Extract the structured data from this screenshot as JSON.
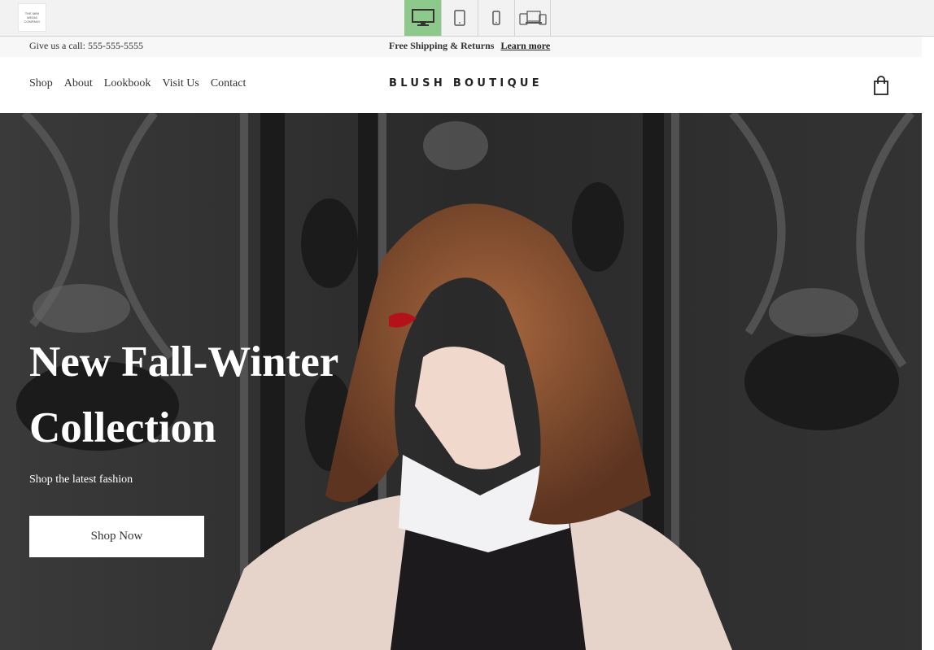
{
  "toolbar": {
    "logo_text": "THE MINI MEDIA COMPANY",
    "devices": [
      {
        "icon": "desktop-icon",
        "active": true
      },
      {
        "icon": "tablet-icon",
        "active": false
      },
      {
        "icon": "mobile-icon",
        "active": false
      },
      {
        "icon": "all-devices-icon",
        "active": false
      }
    ],
    "active_color": "#8cc98a"
  },
  "announcement": {
    "phone_text": "Give us a call: 555-555-5555",
    "shipping_text": "Free Shipping & Returns",
    "learn_more": "Learn more"
  },
  "header": {
    "nav": [
      "Shop",
      "About",
      "Lookbook",
      "Visit Us",
      "Contact"
    ],
    "brand": "BLUSH BOUTIQUE",
    "cart_icon": "shopping-bag-icon"
  },
  "hero": {
    "title": "New Fall-Winter Collection",
    "subtitle": "Shop the latest fashion",
    "button": "Shop Now"
  }
}
